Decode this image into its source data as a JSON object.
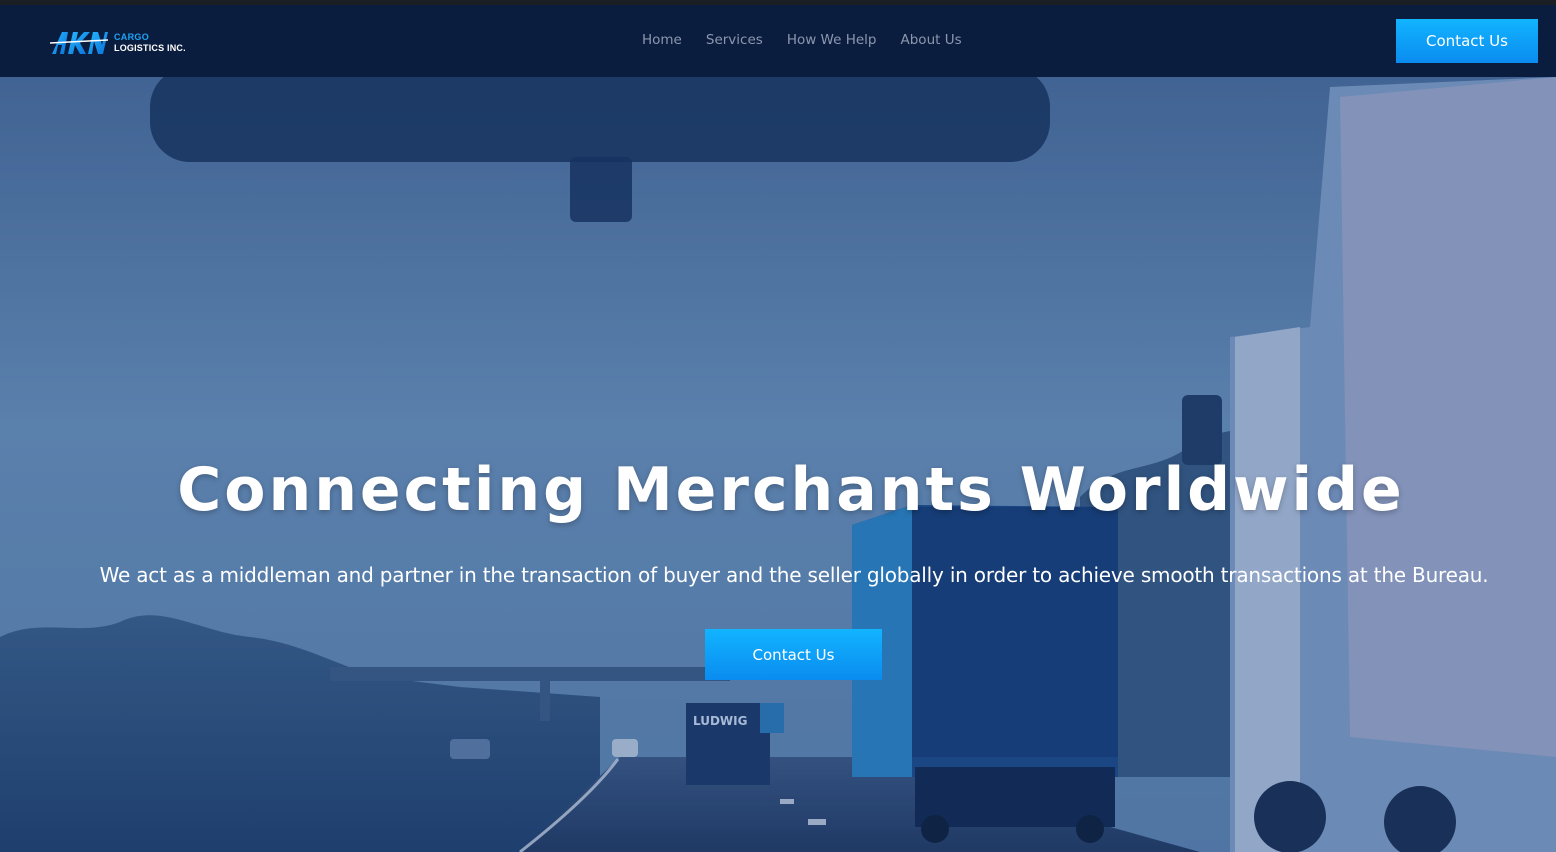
{
  "brand": {
    "logo_mark": "AKN",
    "logo_line1": "CARGO",
    "logo_line2": "LOGISTICS INC."
  },
  "nav": {
    "links": [
      {
        "label": "Home"
      },
      {
        "label": "Services"
      },
      {
        "label": "How We Help"
      },
      {
        "label": "About Us"
      }
    ],
    "cta_label": "Contact Us"
  },
  "hero": {
    "title": "Connecting Merchants Worldwide",
    "subtitle": "We act as a middleman and partner in the transaction of buyer and the seller globally in order to achieve smooth transactions at the Bureau.",
    "cta_label": "Contact Us",
    "truck_sign": "LUDWIG"
  },
  "colors": {
    "navbar_bg": "#0b1d3f",
    "accent": "#12b4ff",
    "nav_link": "#8a97ad",
    "logo_accent": "#1fa3f2"
  },
  "icons": {
    "logo": "akn-logo-icon"
  }
}
